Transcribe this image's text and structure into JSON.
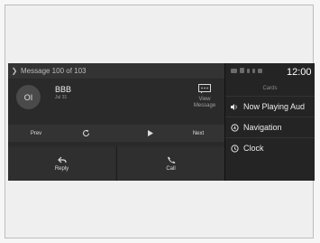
{
  "message": {
    "header": "Message 100 of 103",
    "contact_initials": "OI",
    "contact_name": "BBB",
    "date": "Jul 31",
    "view_label_line1": "View",
    "view_label_line2": "Message"
  },
  "controls": {
    "prev": "Prev",
    "next": "Next"
  },
  "actions": {
    "reply": "Reply",
    "call": "Call"
  },
  "status": {
    "time": "12:00"
  },
  "cards": {
    "title": "Cards",
    "items": [
      {
        "label": "Now Playing Aud",
        "icon": "speaker-icon"
      },
      {
        "label": "Navigation",
        "icon": "navigation-icon"
      },
      {
        "label": "Clock",
        "icon": "clock-icon"
      }
    ]
  }
}
